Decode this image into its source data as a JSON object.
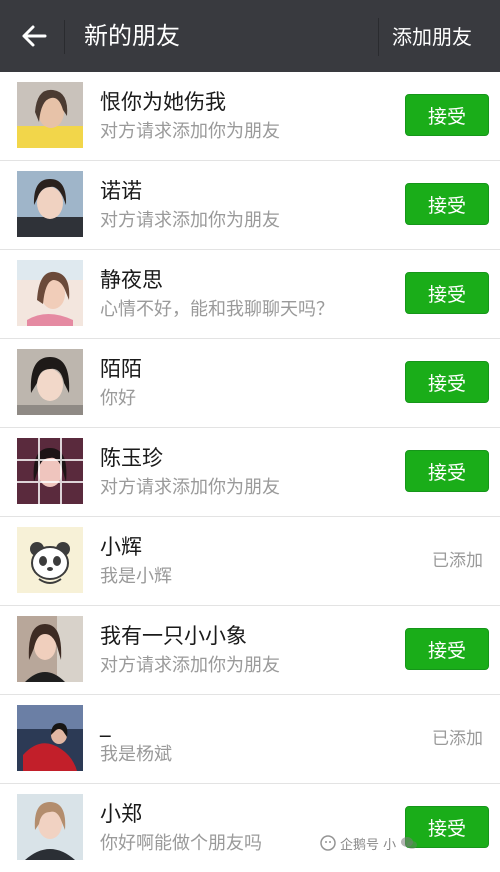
{
  "header": {
    "title": "新的朋友",
    "action_label": "添加朋友",
    "bg_color": "#393a3f"
  },
  "colors": {
    "accept_green": "#1aad19",
    "secondary_text": "#9a9a9a"
  },
  "requests": [
    {
      "name": "恨你为她伤我",
      "message": "对方请求添加你为朋友",
      "status": "接受",
      "avatar_icon": "avatar-photo-icon"
    },
    {
      "name": "诺诺",
      "message": "对方请求添加你为朋友",
      "status": "接受",
      "avatar_icon": "avatar-photo-icon"
    },
    {
      "name": "静夜思",
      "message": "心情不好，能和我聊聊天吗？",
      "status": "接受",
      "avatar_icon": "avatar-photo-icon"
    },
    {
      "name": "陌陌",
      "message": "你好",
      "status": "接受",
      "avatar_icon": "avatar-photo-icon"
    },
    {
      "name": "陈玉珍",
      "message": "对方请求添加你为朋友",
      "status": "接受",
      "avatar_icon": "avatar-photo-icon"
    },
    {
      "name": "小辉",
      "message": "我是小辉",
      "status": "已添加",
      "avatar_icon": "panda-cartoon-icon"
    },
    {
      "name": "我有一只小小象",
      "message": "对方请求添加你为朋友",
      "status": "接受",
      "avatar_icon": "avatar-photo-icon"
    },
    {
      "name": "_",
      "message": "我是杨斌",
      "status": "已添加",
      "avatar_icon": "avatar-photo-icon"
    },
    {
      "name": "小郑",
      "message": "你好啊能做个朋友吗",
      "status": "接受",
      "avatar_icon": "avatar-photo-icon"
    }
  ],
  "watermark": {
    "text": "企鹅号 小"
  }
}
